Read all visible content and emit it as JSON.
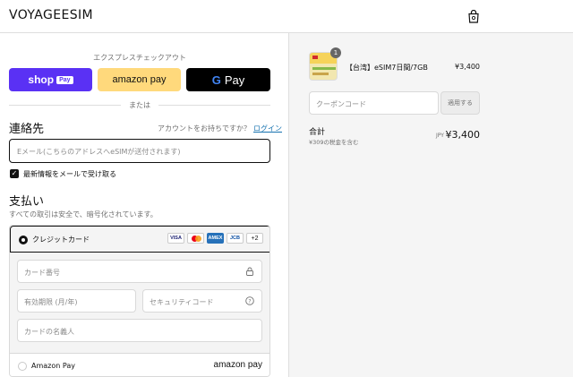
{
  "header": {
    "brand": "VOYAGEESIM",
    "cart_icon": "shopping-bag-icon"
  },
  "express": {
    "title": "エクスプレスチェックアウト",
    "shop_pay": {
      "word": "shop",
      "badge": "Pay",
      "color": "#5a31f4"
    },
    "amazon_pay": {
      "label": "amazon pay",
      "color": "#ffd97c"
    },
    "google_pay": {
      "g": "G",
      "label": "Pay",
      "color": "#000000"
    },
    "or": "または"
  },
  "contact": {
    "heading": "連絡先",
    "login_prompt": "アカウントをお持ちですか？",
    "login_link": "ログイン",
    "email_placeholder": "Eメール(こちらのアドレスへeSIMが送付されます)",
    "newsletter_label": "最新情報をメールで受け取る",
    "newsletter_checked": true
  },
  "payment": {
    "heading": "支払い",
    "note": "すべての取引は安全で、暗号化されています。",
    "credit_card": {
      "label": "クレジットカード",
      "selected": true,
      "logos": [
        "VISA",
        "Mastercard",
        "AMEX",
        "JCB"
      ],
      "more": "+2",
      "card_number_placeholder": "カード番号",
      "expiry_placeholder": "有効期限 (月/年)",
      "security_code_placeholder": "セキュリティコード",
      "name_placeholder": "カードの名義人"
    },
    "amazon_pay": {
      "label": "Amazon Pay",
      "logo_text": "amazon pay",
      "selected": false
    }
  },
  "summary": {
    "item": {
      "quantity": "1",
      "name": "【台湾】eSIM7日間/7GB",
      "price": "¥3,400"
    },
    "coupon_placeholder": "クーポンコード",
    "apply_label": "適用する",
    "total_label": "合計",
    "tax_note": "¥309の税金を含む",
    "currency": "JPY",
    "total": "¥3,400"
  }
}
